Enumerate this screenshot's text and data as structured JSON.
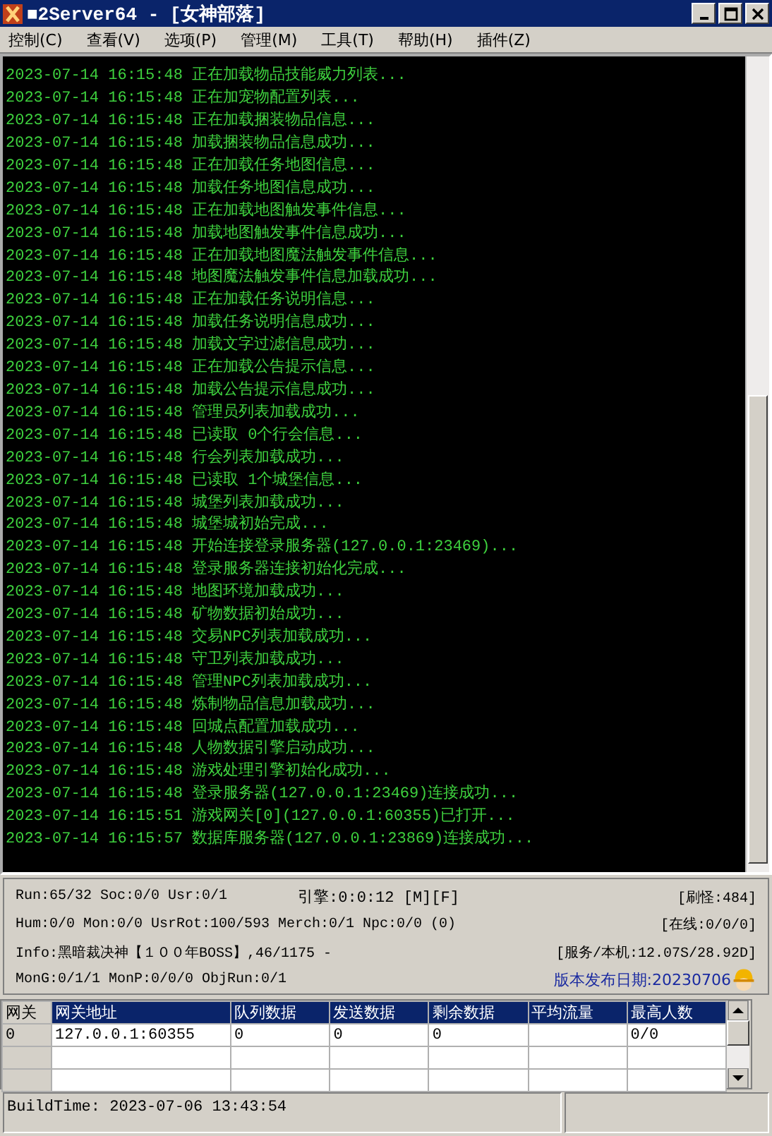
{
  "window": {
    "title": "■2Server64 - [女神部落]"
  },
  "menu": [
    "控制(C)",
    "查看(V)",
    "选项(P)",
    "管理(M)",
    "工具(T)",
    "帮助(H)",
    "插件(Z)"
  ],
  "log": [
    "2023-07-14 16:15:48 正在加载物品技能威力列表...",
    "2023-07-14 16:15:48 正在加宠物配置列表...",
    "2023-07-14 16:15:48 正在加载捆装物品信息...",
    "2023-07-14 16:15:48 加载捆装物品信息成功...",
    "2023-07-14 16:15:48 正在加载任务地图信息...",
    "2023-07-14 16:15:48 加载任务地图信息成功...",
    "2023-07-14 16:15:48 正在加载地图触发事件信息...",
    "2023-07-14 16:15:48 加载地图触发事件信息成功...",
    "2023-07-14 16:15:48 正在加载地图魔法触发事件信息...",
    "2023-07-14 16:15:48 地图魔法触发事件信息加载成功...",
    "2023-07-14 16:15:48 正在加载任务说明信息...",
    "2023-07-14 16:15:48 加载任务说明信息成功...",
    "2023-07-14 16:15:48 加载文字过滤信息成功...",
    "2023-07-14 16:15:48 正在加载公告提示信息...",
    "2023-07-14 16:15:48 加载公告提示信息成功...",
    "2023-07-14 16:15:48 管理员列表加载成功...",
    "2023-07-14 16:15:48 已读取 0个行会信息...",
    "2023-07-14 16:15:48 行会列表加载成功...",
    "2023-07-14 16:15:48 已读取 1个城堡信息...",
    "2023-07-14 16:15:48 城堡列表加载成功...",
    "2023-07-14 16:15:48 城堡城初始完成...",
    "2023-07-14 16:15:48 开始连接登录服务器(127.0.0.1:23469)...",
    "2023-07-14 16:15:48 登录服务器连接初始化完成...",
    "2023-07-14 16:15:48 地图环境加载成功...",
    "2023-07-14 16:15:48 矿物数据初始成功...",
    "2023-07-14 16:15:48 交易NPC列表加载成功...",
    "2023-07-14 16:15:48 守卫列表加载成功...",
    "2023-07-14 16:15:48 管理NPC列表加载成功...",
    "2023-07-14 16:15:48 炼制物品信息加载成功...",
    "2023-07-14 16:15:48 回城点配置加载成功...",
    "2023-07-14 16:15:48 人物数据引擎启动成功...",
    "2023-07-14 16:15:48 游戏处理引擎初始化成功...",
    "2023-07-14 16:15:48 登录服务器(127.0.0.1:23469)连接成功...",
    "2023-07-14 16:15:51 游戏网关[0](127.0.0.1:60355)已打开...",
    "2023-07-14 16:15:57 数据库服务器(127.0.0.1:23869)连接成功..."
  ],
  "stats": {
    "run": "Run:65/32 Soc:0/0 Usr:0/1",
    "engine": "引擎:0:0:12 [M][F]",
    "spawn": "[刷怪:484]",
    "hum": "Hum:0/0 Mon:0/0 UsrRot:100/593 Merch:0/1 Npc:0/0 (0)",
    "online": "[在线:0/0/0]",
    "info": "Info:黑暗裁决神【１００年BOSS】,46/1175 -",
    "service": "[服务/本机:12.07S/28.92D]",
    "mong": "MonG:0/1/1 MonP:0/0/0 ObjRun:0/1",
    "version_label": "版本发布日期:",
    "version_value": "20230706"
  },
  "grid": {
    "corner": "网关",
    "columns": [
      "网关地址",
      "队列数据",
      "发送数据",
      "剩余数据",
      "平均流量",
      "最高人数"
    ],
    "rows": [
      {
        "header": "0",
        "cells": [
          "127.0.0.1:60355",
          "0",
          "0",
          "0",
          "",
          "0/0"
        ]
      },
      {
        "header": "",
        "cells": [
          "",
          "",
          "",
          "",
          "",
          ""
        ]
      },
      {
        "header": "",
        "cells": [
          "",
          "",
          "",
          "",
          "",
          ""
        ]
      }
    ]
  },
  "status_bar": "BuildTime: 2023-07-06 13:43:54"
}
